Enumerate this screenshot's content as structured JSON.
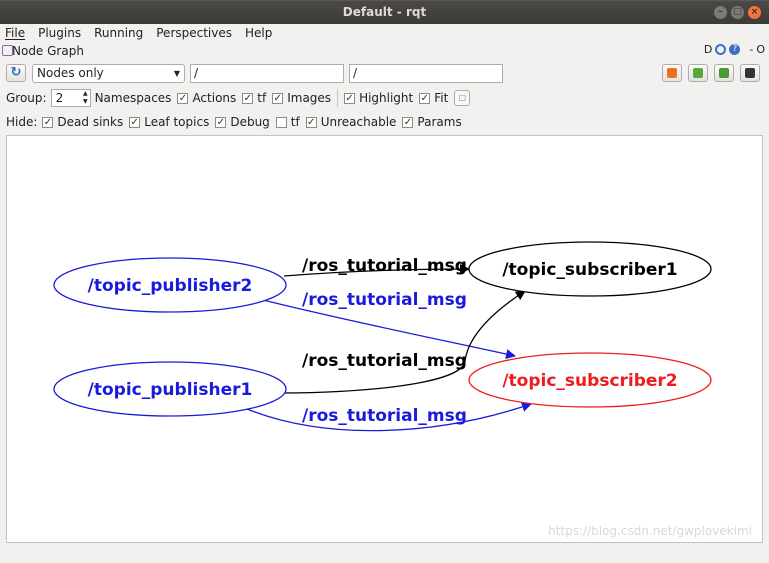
{
  "window": {
    "title": "Default - rqt"
  },
  "menu": [
    {
      "label": "File",
      "hot": "F"
    },
    {
      "label": "Plugins",
      "hot": "P"
    },
    {
      "label": "Running",
      "hot": "R"
    },
    {
      "label": "Perspectives",
      "hot": "P"
    },
    {
      "label": "Help",
      "hot": "H"
    }
  ],
  "plugin": {
    "title": "Node Graph",
    "dock_label": "D",
    "help": "?",
    "minimize": "-",
    "close": "O"
  },
  "toolbar": {
    "mode_value": "Nodes only",
    "filter1_value": "/",
    "filter2_value": "/"
  },
  "group_row": {
    "group_label": "Group:",
    "group_value": "2",
    "namespaces_label": "Namespaces",
    "actions_label": "Actions",
    "actions_checked": true,
    "tf_label": "tf",
    "tf_checked": true,
    "images_label": "Images",
    "images_checked": true,
    "highlight_label": "Highlight",
    "highlight_checked": true,
    "fit_label": "Fit",
    "fit_checked": true
  },
  "hide_row": {
    "hide_label": "Hide:",
    "dead_sinks_label": "Dead sinks",
    "dead_sinks_checked": true,
    "leaf_topics_label": "Leaf topics",
    "leaf_topics_checked": true,
    "debug_label": "Debug",
    "debug_checked": true,
    "tf_label": "tf",
    "tf_checked": false,
    "unreachable_label": "Unreachable",
    "unreachable_checked": true,
    "params_label": "Params",
    "params_checked": true
  },
  "graph": {
    "nodes": {
      "publisher2": "/topic_publisher2",
      "publisher1": "/topic_publisher1",
      "subscriber1": "/topic_subscriber1",
      "subscriber2": "/topic_subscriber2"
    },
    "edges": {
      "p2_s1": "/ros_tutorial_msg",
      "p2_s2": "/ros_tutorial_msg",
      "p1_s1": "/ros_tutorial_msg",
      "p1_s2": "/ros_tutorial_msg"
    },
    "colors": {
      "blue": "#1a1adb",
      "red": "#ee1c1c",
      "black": "#000000"
    }
  },
  "watermark": "https://blog.csdn.net/gwplovekimi"
}
